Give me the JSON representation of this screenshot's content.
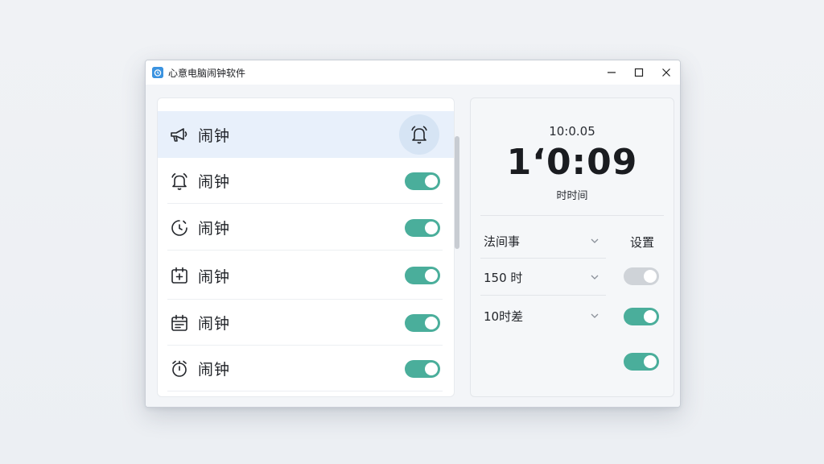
{
  "window": {
    "title": "心意电脑闹钟软件",
    "app_icon_glyph": "⏰",
    "controls": {
      "minimize": "minimize-icon",
      "maximize": "maximize-icon",
      "close": "close-icon"
    }
  },
  "alarm_list": {
    "items": [
      {
        "label": "闹钟",
        "icon": "megaphone-icon",
        "selected": true,
        "control": "bell-button"
      },
      {
        "label": "闹钟",
        "icon": "bell-icon",
        "enabled": true
      },
      {
        "label": "闹钟",
        "icon": "timer-icon",
        "enabled": true
      },
      {
        "label": "闹钟",
        "icon": "calendar-add-icon",
        "enabled": true
      },
      {
        "label": "闹钟",
        "icon": "calendar-icon",
        "enabled": true
      },
      {
        "label": "闹钟",
        "icon": "alarm-clock-icon",
        "enabled": true
      }
    ]
  },
  "clock": {
    "small_time": "10:0.05",
    "big_time": "1‘0:09",
    "subtitle": "时时间"
  },
  "settings": {
    "header": "设置",
    "dropdowns": [
      {
        "value": "法间事"
      },
      {
        "value": "150 时"
      },
      {
        "value": "10时差"
      }
    ],
    "toggles": [
      {
        "state": "off"
      },
      {
        "state": "on"
      },
      {
        "state": "on"
      }
    ]
  },
  "colors": {
    "accent_toggle": "#4aae9b",
    "toggle_off": "#cfd3d8",
    "selected_row": "#e8f0fb",
    "app_icon": "#3b93e0"
  }
}
